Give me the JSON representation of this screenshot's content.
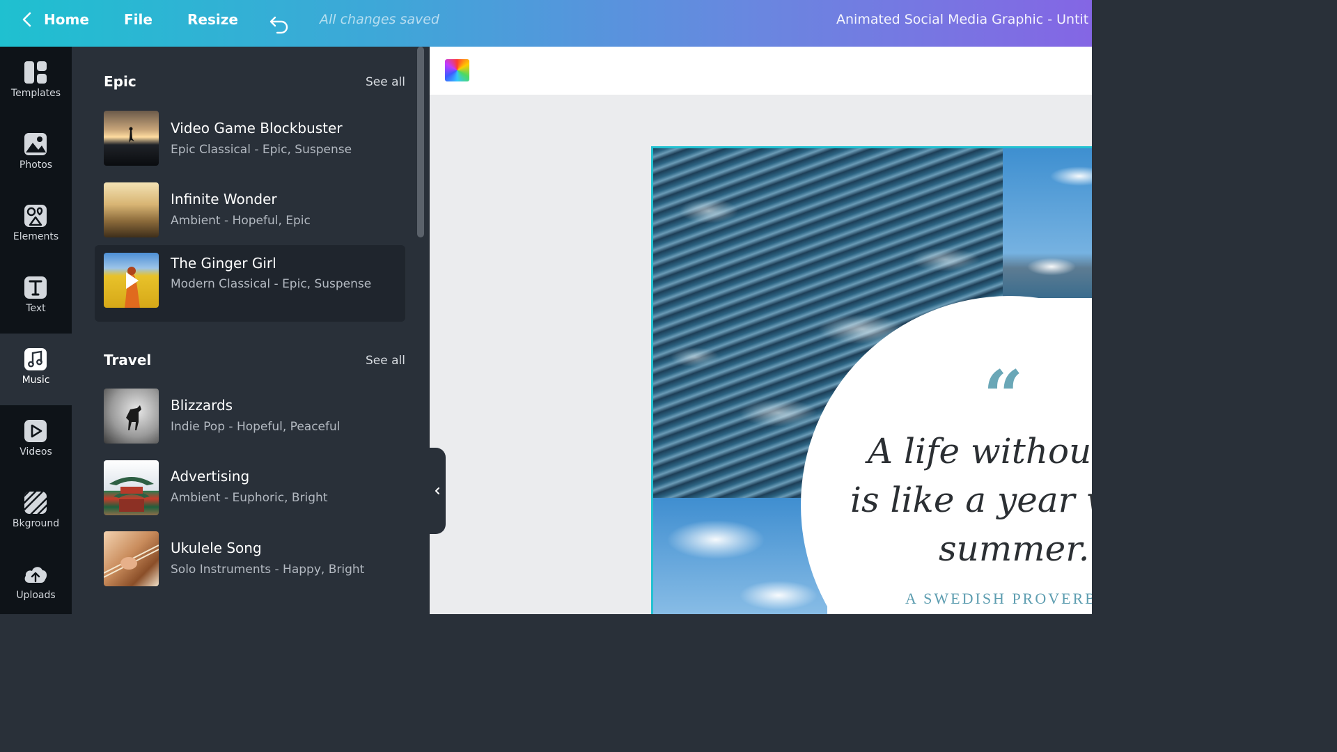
{
  "topbar": {
    "home_label": "Home",
    "file_label": "File",
    "resize_label": "Resize",
    "status": "All changes saved",
    "doc_title": "Animated Social Media Graphic - Untit"
  },
  "rail": {
    "items": [
      {
        "label": "Templates",
        "icon": "templates-icon"
      },
      {
        "label": "Photos",
        "icon": "photos-icon"
      },
      {
        "label": "Elements",
        "icon": "elements-icon"
      },
      {
        "label": "Text",
        "icon": "text-icon"
      },
      {
        "label": "Music",
        "icon": "music-icon",
        "active": true
      },
      {
        "label": "Videos",
        "icon": "videos-icon"
      },
      {
        "label": "Bkground",
        "icon": "background-icon"
      },
      {
        "label": "Uploads",
        "icon": "uploads-icon"
      }
    ]
  },
  "panel": {
    "sections": [
      {
        "title": "Epic",
        "see_all": "See all",
        "tracks": [
          {
            "name": "Video Game Blockbuster",
            "meta": "Epic Classical - Epic, Suspense"
          },
          {
            "name": "Infinite Wonder",
            "meta": "Ambient - Hopeful, Epic"
          },
          {
            "name": "The Ginger Girl",
            "meta": "Modern Classical - Epic, Suspense"
          }
        ]
      },
      {
        "title": "Travel",
        "see_all": "See all",
        "tracks": [
          {
            "name": "Blizzards",
            "meta": "Indie Pop - Hopeful, Peaceful"
          },
          {
            "name": "Advertising",
            "meta": "Ambient - Euphoric, Bright"
          },
          {
            "name": "Ukulele Song",
            "meta": "Solo Instruments - Happy, Bright"
          }
        ]
      }
    ]
  },
  "design": {
    "quote_lines": [
      "A life without lo",
      "is like a year with",
      "summer."
    ],
    "attribution": "A SWEDISH PROVERB",
    "quote_mark": "“"
  },
  "colors": {
    "accent": "#22c1d1",
    "panel_bg": "#293039",
    "rail_bg": "#0e1318",
    "quote_accent": "#6aa7b7"
  }
}
